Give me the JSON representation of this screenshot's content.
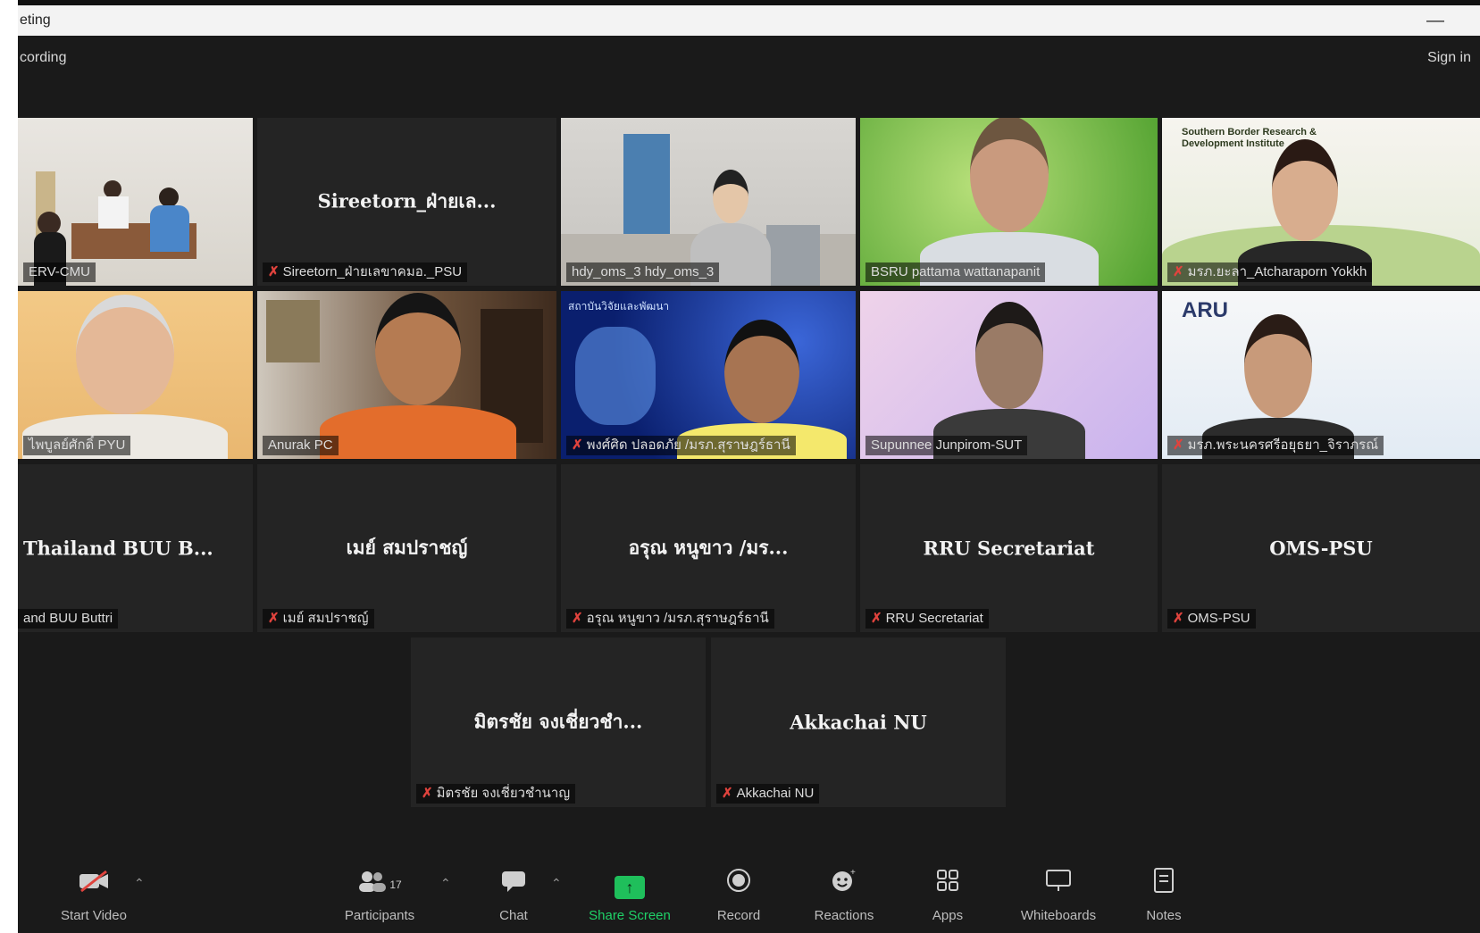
{
  "window": {
    "title": "eting",
    "minimize": "—"
  },
  "header": {
    "recording": "cording",
    "sign_in": "Sign in"
  },
  "tiles": [
    {
      "label": "ERV-CMU",
      "center_name": "",
      "mic_muted": false
    },
    {
      "label": "Sireetorn_ฝ่ายเลขาคมอ._PSU",
      "center_name": "Sireetorn_ฝ่ายเล...",
      "mic_muted": true
    },
    {
      "label": "hdy_oms_3 hdy_oms_3",
      "center_name": "",
      "mic_muted": false
    },
    {
      "label": "BSRU pattama wattanapanit",
      "center_name": "",
      "mic_muted": false
    },
    {
      "label": "มรภ.ยะลา_Atcharaporn Yokkh",
      "center_name": "",
      "mic_muted": true
    },
    {
      "label": "ไพบูลย์ศักดิ์ PYU",
      "center_name": "",
      "mic_muted": false
    },
    {
      "label": "Anurak PC",
      "center_name": "",
      "mic_muted": false
    },
    {
      "label": "พงศ์ศิด ปลอดภัย /มรภ.สุราษฎร์ธานี",
      "center_name": "",
      "mic_muted": true
    },
    {
      "label": "Supunnee Junpirom-SUT",
      "center_name": "",
      "mic_muted": false
    },
    {
      "label": "มรภ.พระนครศรีอยุธยา_จิราภรณ์",
      "center_name": "",
      "mic_muted": true
    },
    {
      "label": "and BUU Buttri",
      "center_name": "Thailand BUU B...",
      "mic_muted": false
    },
    {
      "label": "เมย์ สมปราชญ์",
      "center_name": "เมย์ สมปราชญ์",
      "mic_muted": true
    },
    {
      "label": "อรุณ หนูขาว /มรภ.สุราษฎร์ธานี",
      "center_name": "อรุณ หนูขาว /มร...",
      "mic_muted": true
    },
    {
      "label": "RRU Secretariat",
      "center_name": "RRU Secretariat",
      "mic_muted": true
    },
    {
      "label": "OMS-PSU",
      "center_name": "OMS-PSU",
      "mic_muted": true
    },
    {
      "label": "มิตรชัย จงเชี่ยวชำนาญ",
      "center_name": "มิตรชัย จงเชี่ยวชำ...",
      "mic_muted": true
    },
    {
      "label": "Akkachai NU",
      "center_name": "Akkachai NU",
      "mic_muted": true
    }
  ],
  "scene_texts": {
    "t5_sign": "Southern Border Research & Development Institute",
    "t10_logo": "ARU",
    "t8_banner": "สถาบันวิจัยและพัฒนา"
  },
  "toolbar": {
    "start_video": "Start Video",
    "participants": "Participants",
    "participants_count": "17",
    "chat": "Chat",
    "share_screen": "Share Screen",
    "record": "Record",
    "reactions": "Reactions",
    "apps": "Apps",
    "whiteboards": "Whiteboards",
    "notes": "Notes"
  },
  "icons": {
    "start_video": "video-off-icon",
    "participants": "participants-icon",
    "chat": "chat-icon",
    "share_screen": "share-screen-icon",
    "record": "record-icon",
    "reactions": "reactions-icon",
    "apps": "apps-icon",
    "whiteboards": "whiteboard-icon",
    "notes": "notes-icon"
  },
  "colors": {
    "active_speaker": "#c9d548",
    "share_green": "#1fbf5b",
    "muted_red": "#e0433d"
  }
}
